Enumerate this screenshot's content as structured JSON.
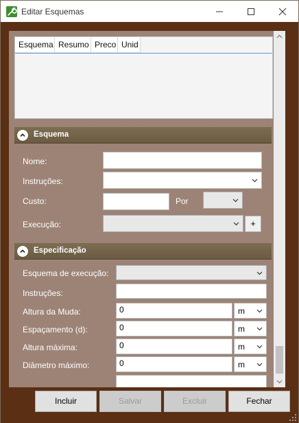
{
  "window": {
    "title": "Editar Esquemas",
    "accent": "#5a2f14",
    "panel_color": "#9c8376",
    "section_color": "#7d6d52"
  },
  "grid": {
    "columns": [
      "Esquema",
      "Resumo",
      "Preco",
      "Unid"
    ],
    "rows": []
  },
  "esquema": {
    "header": "Esquema",
    "nome_label": "Nome:",
    "nome_value": "",
    "instrucoes_label": "Instruções:",
    "custo_label": "Custo:",
    "custo_value": "",
    "por_label": "Por",
    "execucao_label": "Execução:",
    "add_label": "+"
  },
  "especificacao": {
    "header": "Especificação",
    "esquema_exec_label": "Esquema de execução:",
    "instrucoes_label": "Instruções:",
    "instrucoes_value": "",
    "altura_muda_label": "Altura da Muda:",
    "altura_muda_value": "0",
    "altura_muda_unit": "m",
    "espacamento_label": "Espaçamento (d):",
    "espacamento_value": "0",
    "espacamento_unit": "m",
    "altura_max_label": "Altura máxima:",
    "altura_max_value": "0",
    "altura_max_unit": "m",
    "diametro_label": "Diâmetro máximo:",
    "diametro_value": "0",
    "diametro_unit": "m"
  },
  "buttons": {
    "incluir": "Incluir",
    "salvar": "Salvar",
    "excluir": "Excluir",
    "fechar": "Fechar"
  },
  "icons": {
    "app": "wrench-icon",
    "minimize": "minimize-icon",
    "maximize": "maximize-icon",
    "close": "close-icon",
    "collapse": "chevron-up-icon",
    "dropdown": "chevron-down-icon"
  }
}
